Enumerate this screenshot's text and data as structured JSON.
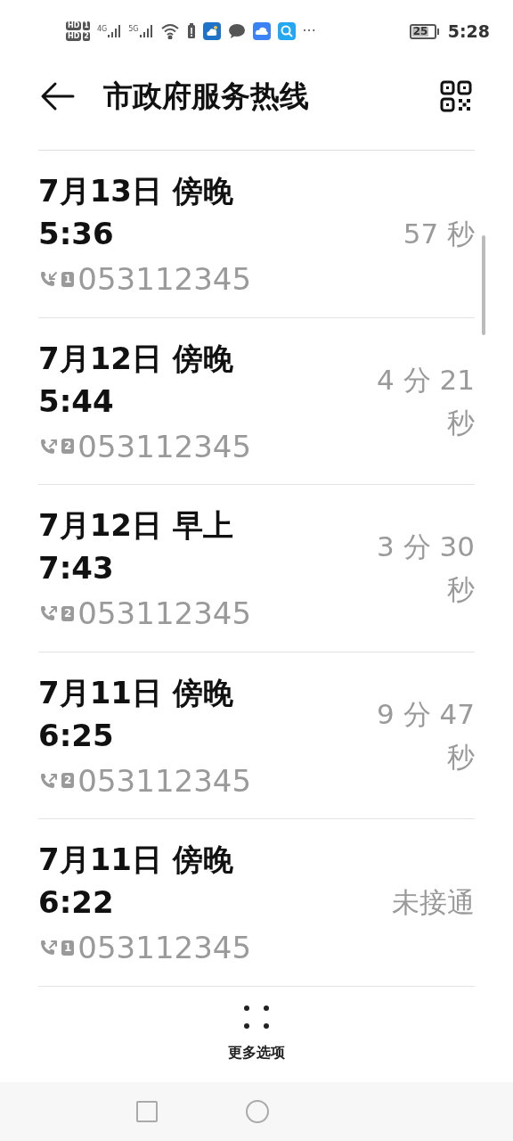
{
  "status_bar": {
    "sim_labels": [
      "HD",
      "HD"
    ],
    "sim_numbers": [
      "1",
      "2"
    ],
    "networks": [
      "4G",
      "5G"
    ],
    "more": "···",
    "battery": "25",
    "time": "5:28"
  },
  "header": {
    "title": "市政府服务热线"
  },
  "calls": [
    {
      "date": "7月13日 傍晚",
      "time": "5:36",
      "kind": "incoming",
      "sim": "1",
      "number": "053112345",
      "duration": "57 秒"
    },
    {
      "date": "7月12日 傍晚",
      "time": "5:44",
      "kind": "outgoing",
      "sim": "2",
      "number": "053112345",
      "duration": "4 分 21 秒"
    },
    {
      "date": "7月12日 早上",
      "time": "7:43",
      "kind": "outgoing",
      "sim": "2",
      "number": "053112345",
      "duration": "3 分 30 秒"
    },
    {
      "date": "7月11日 傍晚",
      "time": "6:25",
      "kind": "outgoing",
      "sim": "2",
      "number": "053112345",
      "duration": "9 分 47 秒"
    },
    {
      "date": "7月11日 傍晚",
      "time": "6:22",
      "kind": "outgoing",
      "sim": "1",
      "number": "053112345",
      "duration": "未接通"
    }
  ],
  "more_options": {
    "label": "更多选项"
  }
}
